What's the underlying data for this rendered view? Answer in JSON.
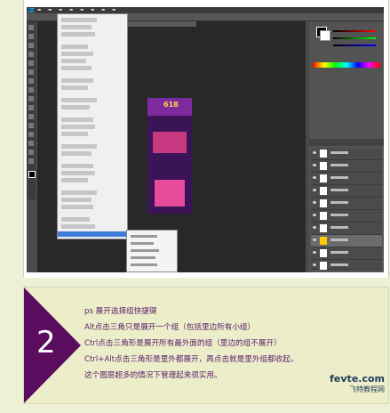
{
  "screenshot": {
    "app": "Photoshop",
    "menubar": [
      "Ps",
      "",
      "",
      "",
      "",
      "",
      "",
      "",
      ""
    ],
    "poster_text": "618"
  },
  "tip": {
    "step_number": "2",
    "lines": [
      "ps 展开选择组快捷键",
      "Alt点击三角只是展开一个组（包括里边所有小组）",
      "Ctrl点击三角形是展开所有最外面的组（里边的组不展开）",
      "Ctrl+Alt点击三角形是里外都展开，再点击就是里外组都收起，",
      "这个图层超多的情况下管理起来很实用。"
    ],
    "accent_color": "#5a0d5e",
    "text_color": "#5a1e6b"
  },
  "watermark": {
    "line1": "fevte.com",
    "line2": "飞特教程网"
  }
}
